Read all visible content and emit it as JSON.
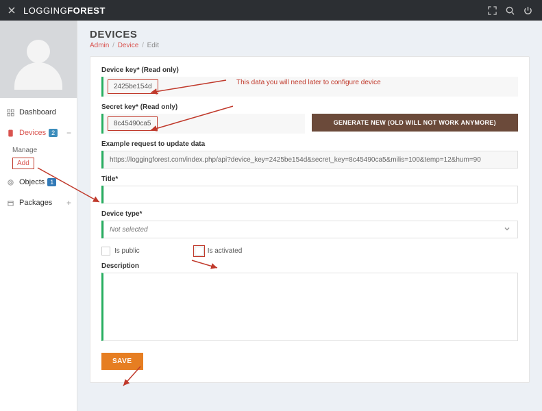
{
  "header": {
    "brand_normal": "LOGGING",
    "brand_bold": "FOREST"
  },
  "sidebar": {
    "items": [
      {
        "label": "Dashboard"
      },
      {
        "label": "Devices",
        "badge": "2"
      },
      {
        "label": "Objects",
        "badge": "1"
      },
      {
        "label": "Packages"
      }
    ],
    "devices_sub": {
      "manage": "Manage",
      "add": "Add"
    }
  },
  "page": {
    "title": "DEVICES",
    "crumb_admin": "Admin",
    "crumb_device": "Device",
    "crumb_edit": "Edit"
  },
  "form": {
    "device_key_label": "Device key* (Read only)",
    "device_key_value": "2425be154d",
    "secret_key_label": "Secret key* (Read only)",
    "secret_key_value": "8c45490ca5",
    "generate_btn": "GENERATE NEW (OLD WILL NOT WORK ANYMORE)",
    "example_label": "Example request to update data",
    "example_value": "https://loggingforest.com/index.php/api?device_key=2425be154d&secret_key=8c45490ca5&milis=100&temp=12&hum=90",
    "title_label": "Title*",
    "title_value": "",
    "device_type_label": "Device type*",
    "device_type_placeholder": "Not selected",
    "is_public_label": "Is public",
    "is_activated_label": "Is activated",
    "description_label": "Description",
    "description_value": "",
    "save_btn": "SAVE"
  },
  "annotation": {
    "note": "This data you will need later to configure device"
  }
}
